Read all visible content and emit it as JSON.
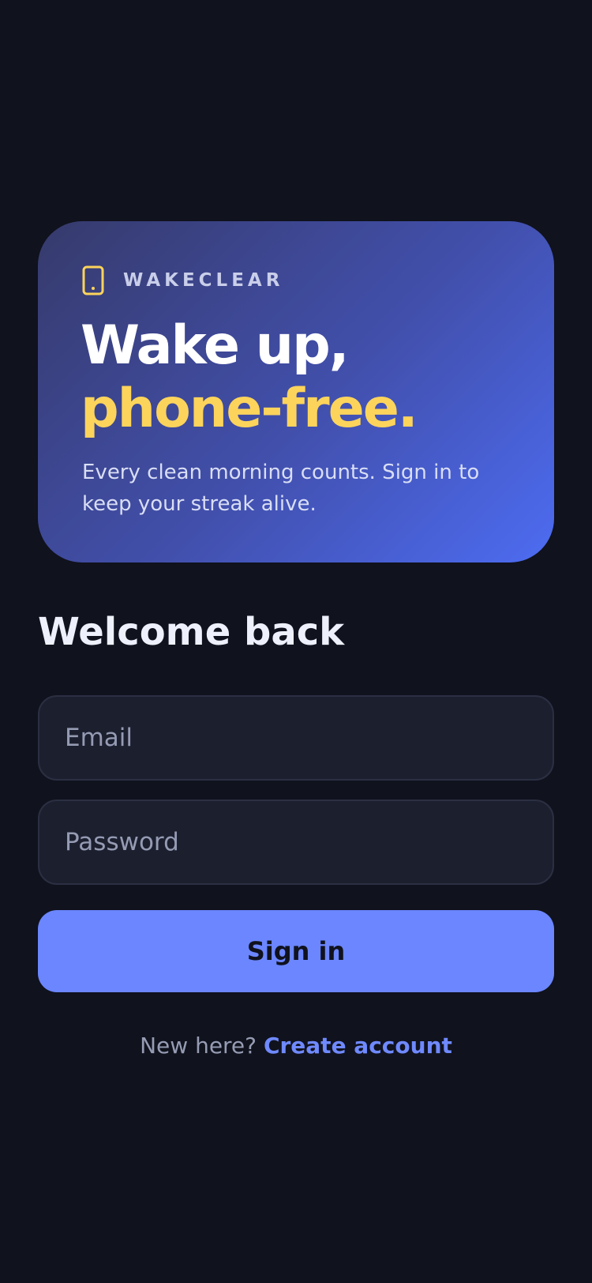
{
  "hero": {
    "brand_icon": "phone-icon",
    "brand_name": "WAKECLEAR",
    "headline_line1": "Wake up,",
    "headline_line2": "phone-free.",
    "subtitle": "Every clean morning counts. Sign in to keep your streak alive.",
    "accent_color": "#fcd45b"
  },
  "form": {
    "title": "Welcome back",
    "email_placeholder": "Email",
    "password_placeholder": "Password",
    "submit_label": "Sign in",
    "submit_color": "#6b86ff"
  },
  "footer": {
    "prompt": "New here?",
    "link_label": "Create account"
  }
}
